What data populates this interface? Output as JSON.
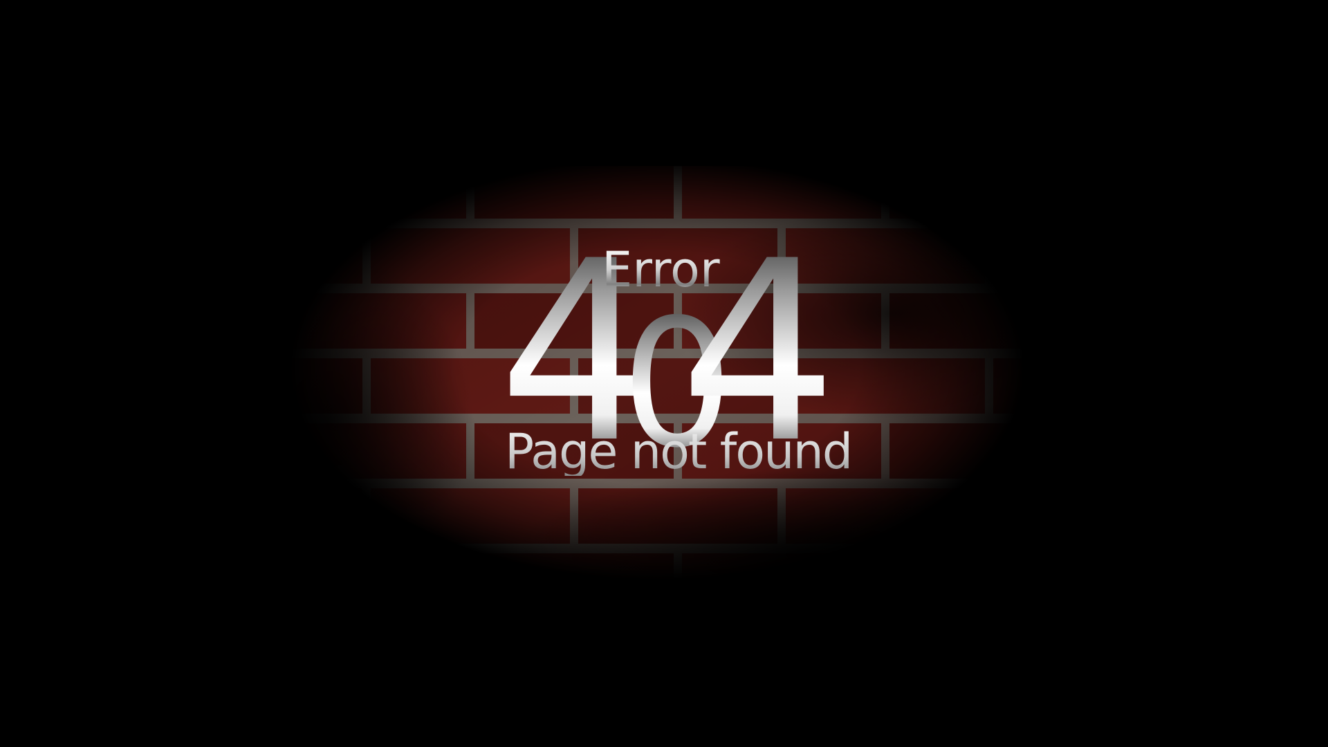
{
  "error_page": {
    "heading": "Error",
    "code_digits": [
      "4",
      "0",
      "4"
    ],
    "message": "Page not found"
  },
  "colors": {
    "background": "#000000",
    "brick": "#5a1814",
    "mortar": "#7a7068",
    "text": "#ffffff"
  }
}
